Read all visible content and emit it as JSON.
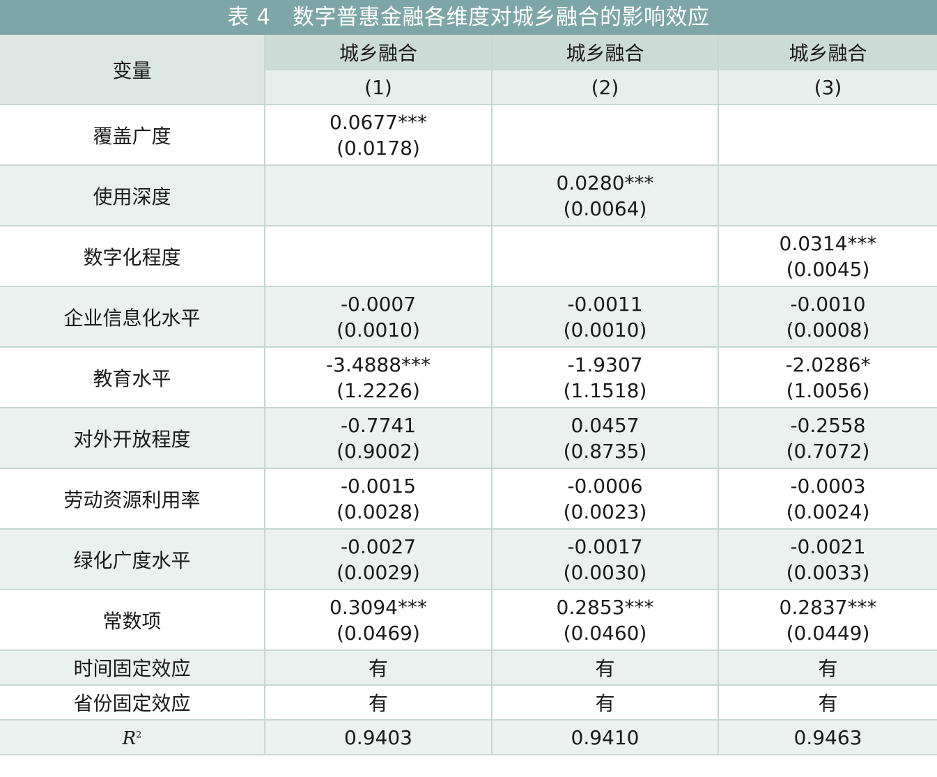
{
  "title": "表 4　数字普惠金融各维度对城乡融合的影响效应",
  "header": {
    "var_label": "变量",
    "dep_vars": [
      "城乡融合",
      "城乡融合",
      "城乡融合"
    ],
    "model_nums": [
      "(1)",
      "(2)",
      "(3)"
    ]
  },
  "rows": [
    {
      "label": "覆盖广度",
      "cells": [
        {
          "coef": "0.0677***",
          "se": "(0.0178)"
        },
        {
          "coef": "",
          "se": ""
        },
        {
          "coef": "",
          "se": ""
        }
      ]
    },
    {
      "label": "使用深度",
      "cells": [
        {
          "coef": "",
          "se": ""
        },
        {
          "coef": "0.0280***",
          "se": "(0.0064)"
        },
        {
          "coef": "",
          "se": ""
        }
      ]
    },
    {
      "label": "数字化程度",
      "cells": [
        {
          "coef": "",
          "se": ""
        },
        {
          "coef": "",
          "se": ""
        },
        {
          "coef": "0.0314***",
          "se": "(0.0045)"
        }
      ]
    },
    {
      "label": "企业信息化水平",
      "cells": [
        {
          "coef": "-0.0007",
          "se": "(0.0010)"
        },
        {
          "coef": "-0.0011",
          "se": "(0.0010)"
        },
        {
          "coef": "-0.0010",
          "se": "(0.0008)"
        }
      ]
    },
    {
      "label": "教育水平",
      "cells": [
        {
          "coef": "-3.4888***",
          "se": "(1.2226)"
        },
        {
          "coef": "-1.9307",
          "se": "(1.1518)"
        },
        {
          "coef": "-2.0286*",
          "se": "(1.0056)"
        }
      ]
    },
    {
      "label": "对外开放程度",
      "cells": [
        {
          "coef": "-0.7741",
          "se": "(0.9002)"
        },
        {
          "coef": "0.0457",
          "se": "(0.8735)"
        },
        {
          "coef": "-0.2558",
          "se": "(0.7072)"
        }
      ]
    },
    {
      "label": "劳动资源利用率",
      "cells": [
        {
          "coef": "-0.0015",
          "se": "(0.0028)"
        },
        {
          "coef": "-0.0006",
          "se": "(0.0023)"
        },
        {
          "coef": "-0.0003",
          "se": "(0.0024)"
        }
      ]
    },
    {
      "label": "绿化广度水平",
      "cells": [
        {
          "coef": "-0.0027",
          "se": "(0.0029)"
        },
        {
          "coef": "-0.0017",
          "se": "(0.0030)"
        },
        {
          "coef": "-0.0021",
          "se": "(0.0033)"
        }
      ]
    },
    {
      "label": "常数项",
      "cells": [
        {
          "coef": "0.3094***",
          "se": "(0.0469)"
        },
        {
          "coef": "0.2853***",
          "se": "(0.0460)"
        },
        {
          "coef": "0.2837***",
          "se": "(0.0449)"
        }
      ]
    }
  ],
  "fixed_effects": [
    {
      "label": "时间固定效应",
      "values": [
        "有",
        "有",
        "有"
      ]
    },
    {
      "label": "省份固定效应",
      "values": [
        "有",
        "有",
        "有"
      ]
    }
  ],
  "r2": {
    "symbol": "R",
    "exp": "2",
    "values": [
      "0.9403",
      "0.9410",
      "0.9463"
    ]
  }
}
